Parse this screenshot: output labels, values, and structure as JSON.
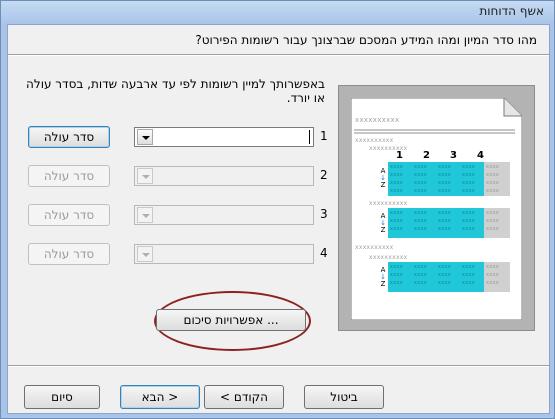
{
  "window": {
    "title": "אשף הדוחות"
  },
  "question": "מהו סדר המיון ומהו המידע המסכם שברצונך עבור רשומות הפירוט?",
  "description": "באפשרותך למיין רשומות לפי עד ארבעה שדות, בסדר עולה או יורד.",
  "sort_rows": [
    {
      "number": "1",
      "field_value": "",
      "button_label": "סדר עולה",
      "enabled": true
    },
    {
      "number": "2",
      "field_value": "",
      "button_label": "סדר עולה",
      "enabled": false
    },
    {
      "number": "3",
      "field_value": "",
      "button_label": "סדר עולה",
      "enabled": false
    },
    {
      "number": "4",
      "field_value": "",
      "button_label": "סדר עולה",
      "enabled": false
    }
  ],
  "summary_options_label": "אפשרויות סיכום ...",
  "preview": {
    "placeholder": "xxxxxxxxxx",
    "column_numbers": [
      "1",
      "2",
      "3",
      "4"
    ],
    "cell_placeholder": "xxxx",
    "sort_icon": {
      "top": "A",
      "bottom": "Z"
    }
  },
  "footer": {
    "cancel_label": "ביטול",
    "back_label": "< הקודם",
    "next_label": "הבא >",
    "finish_label": "סיום"
  },
  "colors": {
    "highlight": "#20c7d9",
    "annotation_circle": "#8b2323"
  }
}
